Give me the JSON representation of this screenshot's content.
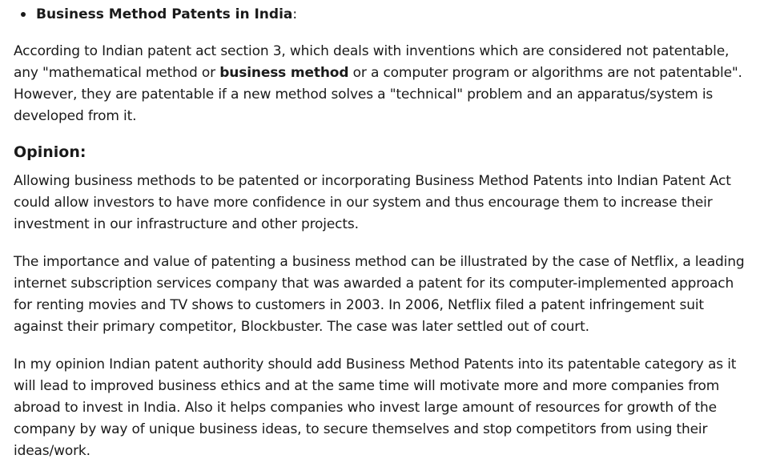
{
  "bullet": {
    "title": "Business Method Patents in India",
    "suffix": ":"
  },
  "para1": {
    "part1": "According to Indian patent act section 3, which deals with inventions which are considered not patentable, any \"mathematical method or ",
    "bold": "business method",
    "part2": " or a computer program or algorithms are not patentable\". However, they are patentable if a new method solves a \"technical\" problem and an apparatus/system is developed from it."
  },
  "opinion_heading": "Opinion:",
  "para2": "Allowing business methods to be patented or incorporating Business Method Patents into Indian Patent Act could allow investors to have more confidence in our system and thus encourage them to increase their investment in our infrastructure and other projects.",
  "para3": "The importance and value of patenting a business method can be illustrated by the case of Netflix, a leading internet subscription services company that was awarded a patent for its computer-implemented approach for renting movies and TV shows to customers in 2003. In 2006, Netflix filed a patent infringement suit against their primary competitor, Blockbuster. The case was later settled out of court.",
  "para4": "In my opinion Indian patent authority should add Business Method Patents into its patentable category as it will lead to improved business ethics and at the same time will motivate more and more companies from abroad to invest in India. Also it helps companies who invest large amount of resources for growth of the company by way of unique business ideas, to secure themselves and stop competitors from using their ideas/work."
}
